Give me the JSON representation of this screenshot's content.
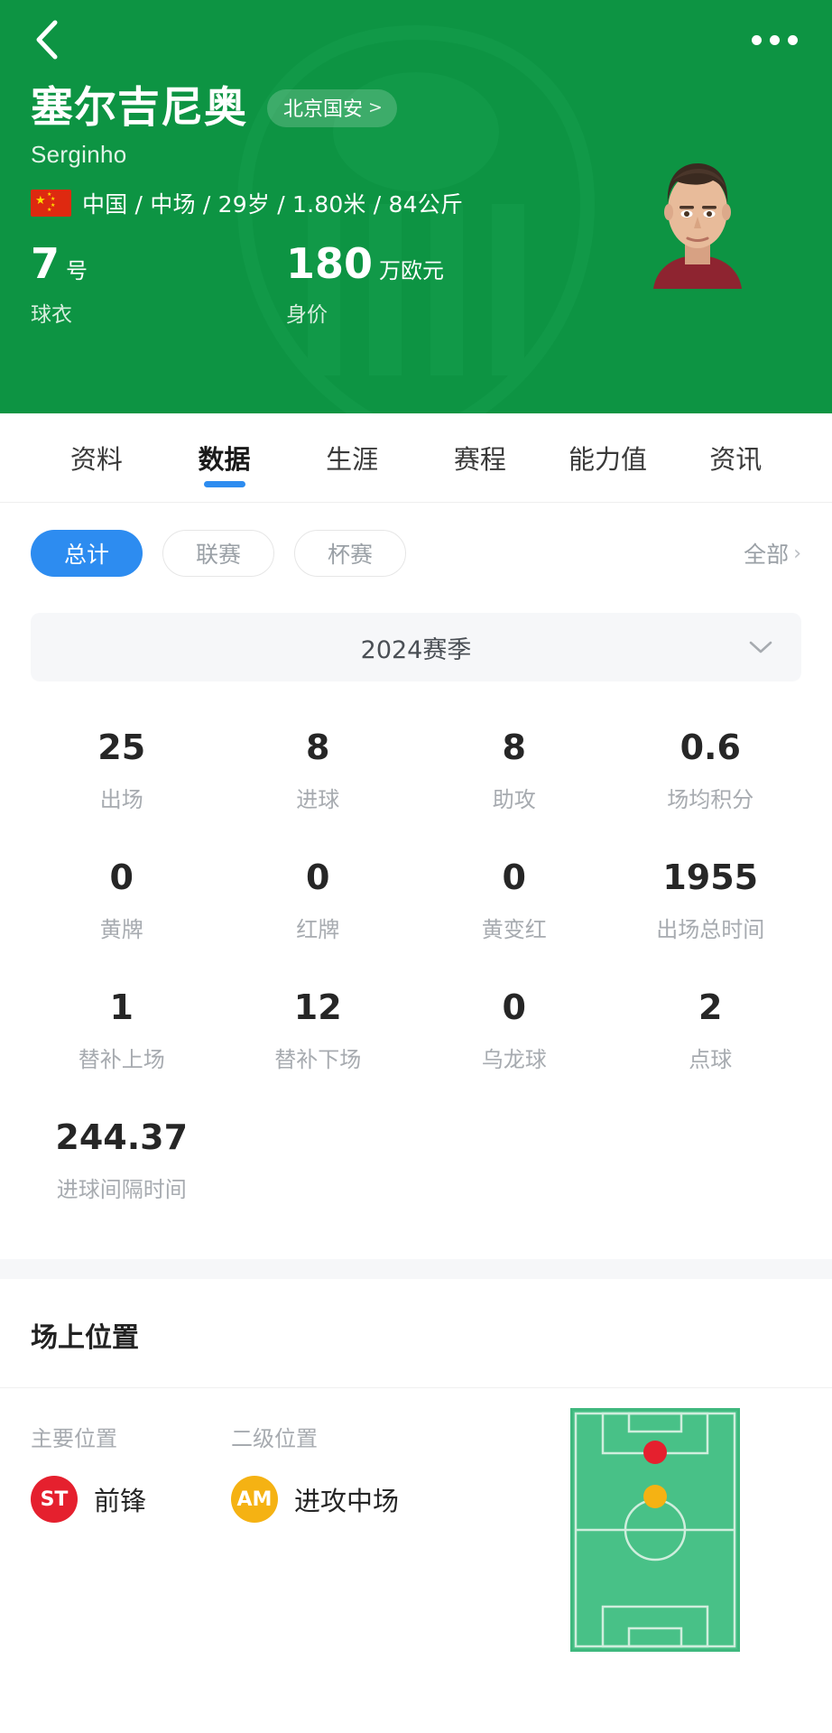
{
  "theme": {
    "header_green": "#0d9443",
    "accent_blue": "#2d8cf0",
    "pitch_green": "#48c187",
    "badge_st_color": "#e5202e",
    "badge_am_color": "#f5b213"
  },
  "navbar": {
    "back_icon": "chevron-left-icon",
    "more_icon": "more-horizontal-icon"
  },
  "player": {
    "name_cn": "塞尔吉尼奥",
    "name_en": "Serginho",
    "team": "北京国安",
    "team_chevron": ">",
    "nationality": "中国",
    "meta_line": "中国 / 中场 / 29岁 / 1.80米 / 84公斤",
    "shirt_number": "7",
    "shirt_number_unit": "号",
    "shirt_label": "球衣",
    "market_value": "180",
    "market_value_unit": "万欧元",
    "market_value_label": "身价"
  },
  "tabs": [
    {
      "label": "资料",
      "active": false
    },
    {
      "label": "数据",
      "active": true
    },
    {
      "label": "生涯",
      "active": false
    },
    {
      "label": "赛程",
      "active": false
    },
    {
      "label": "能力值",
      "active": false
    },
    {
      "label": "资讯",
      "active": false
    }
  ],
  "filters": {
    "chips": [
      {
        "label": "总计",
        "selected": true
      },
      {
        "label": "联赛",
        "selected": false
      },
      {
        "label": "杯赛",
        "selected": false
      }
    ],
    "all_label": "全部",
    "all_chevron": "›"
  },
  "season": {
    "label": "2024赛季",
    "caret_icon": "chevron-down-icon"
  },
  "stats": [
    [
      {
        "value": "25",
        "label": "出场"
      },
      {
        "value": "8",
        "label": "进球"
      },
      {
        "value": "8",
        "label": "助攻"
      },
      {
        "value": "0.6",
        "label": "场均积分"
      }
    ],
    [
      {
        "value": "0",
        "label": "黄牌"
      },
      {
        "value": "0",
        "label": "红牌"
      },
      {
        "value": "0",
        "label": "黄变红"
      },
      {
        "value": "1955",
        "label": "出场总时间"
      }
    ],
    [
      {
        "value": "1",
        "label": "替补上场"
      },
      {
        "value": "12",
        "label": "替补下场"
      },
      {
        "value": "0",
        "label": "乌龙球"
      },
      {
        "value": "2",
        "label": "点球"
      }
    ],
    [
      {
        "value": "244.37",
        "label": "进球间隔时间"
      },
      {
        "value": "",
        "label": ""
      },
      {
        "value": "",
        "label": ""
      },
      {
        "value": "",
        "label": ""
      }
    ]
  ],
  "position_section": {
    "title": "场上位置",
    "primary_label": "主要位置",
    "secondary_label": "二级位置",
    "primary": {
      "code": "ST",
      "name": "前锋"
    },
    "secondary": {
      "code": "AM",
      "name": "进攻中场"
    },
    "pitch_icon": "football-pitch-diagram"
  }
}
